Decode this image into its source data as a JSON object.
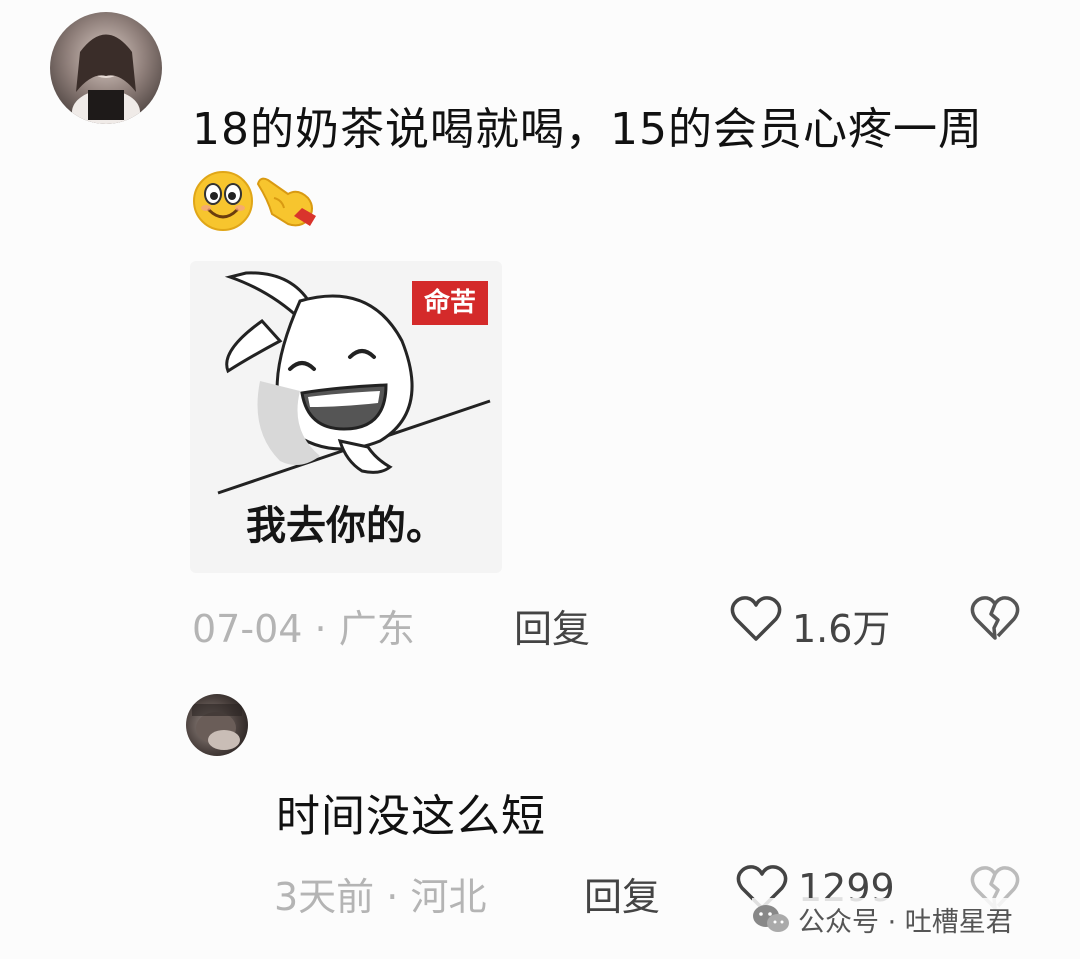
{
  "comment": {
    "text": "18的奶茶说喝就喝，15的会员心疼一周",
    "emojis": [
      "smiling-face-emoji",
      "pointing-hand-emoji"
    ],
    "sticker": {
      "badge": "命苦",
      "caption": "我去你的。"
    },
    "date": "07-04",
    "separator": "·",
    "location": "广东",
    "reply_label": "回复",
    "likes": "1.6万"
  },
  "reply": {
    "text": "时间没这么短",
    "date": "3天前",
    "separator": "·",
    "location": "河北",
    "reply_label": "回复",
    "likes": "1299"
  },
  "watermark": {
    "icon": "wechat-icon",
    "text": "公众号 · 吐槽星君"
  },
  "colors": {
    "meta_gray": "#b4b4b4",
    "meta_dark": "#444444",
    "badge_red": "#d42a2a"
  }
}
